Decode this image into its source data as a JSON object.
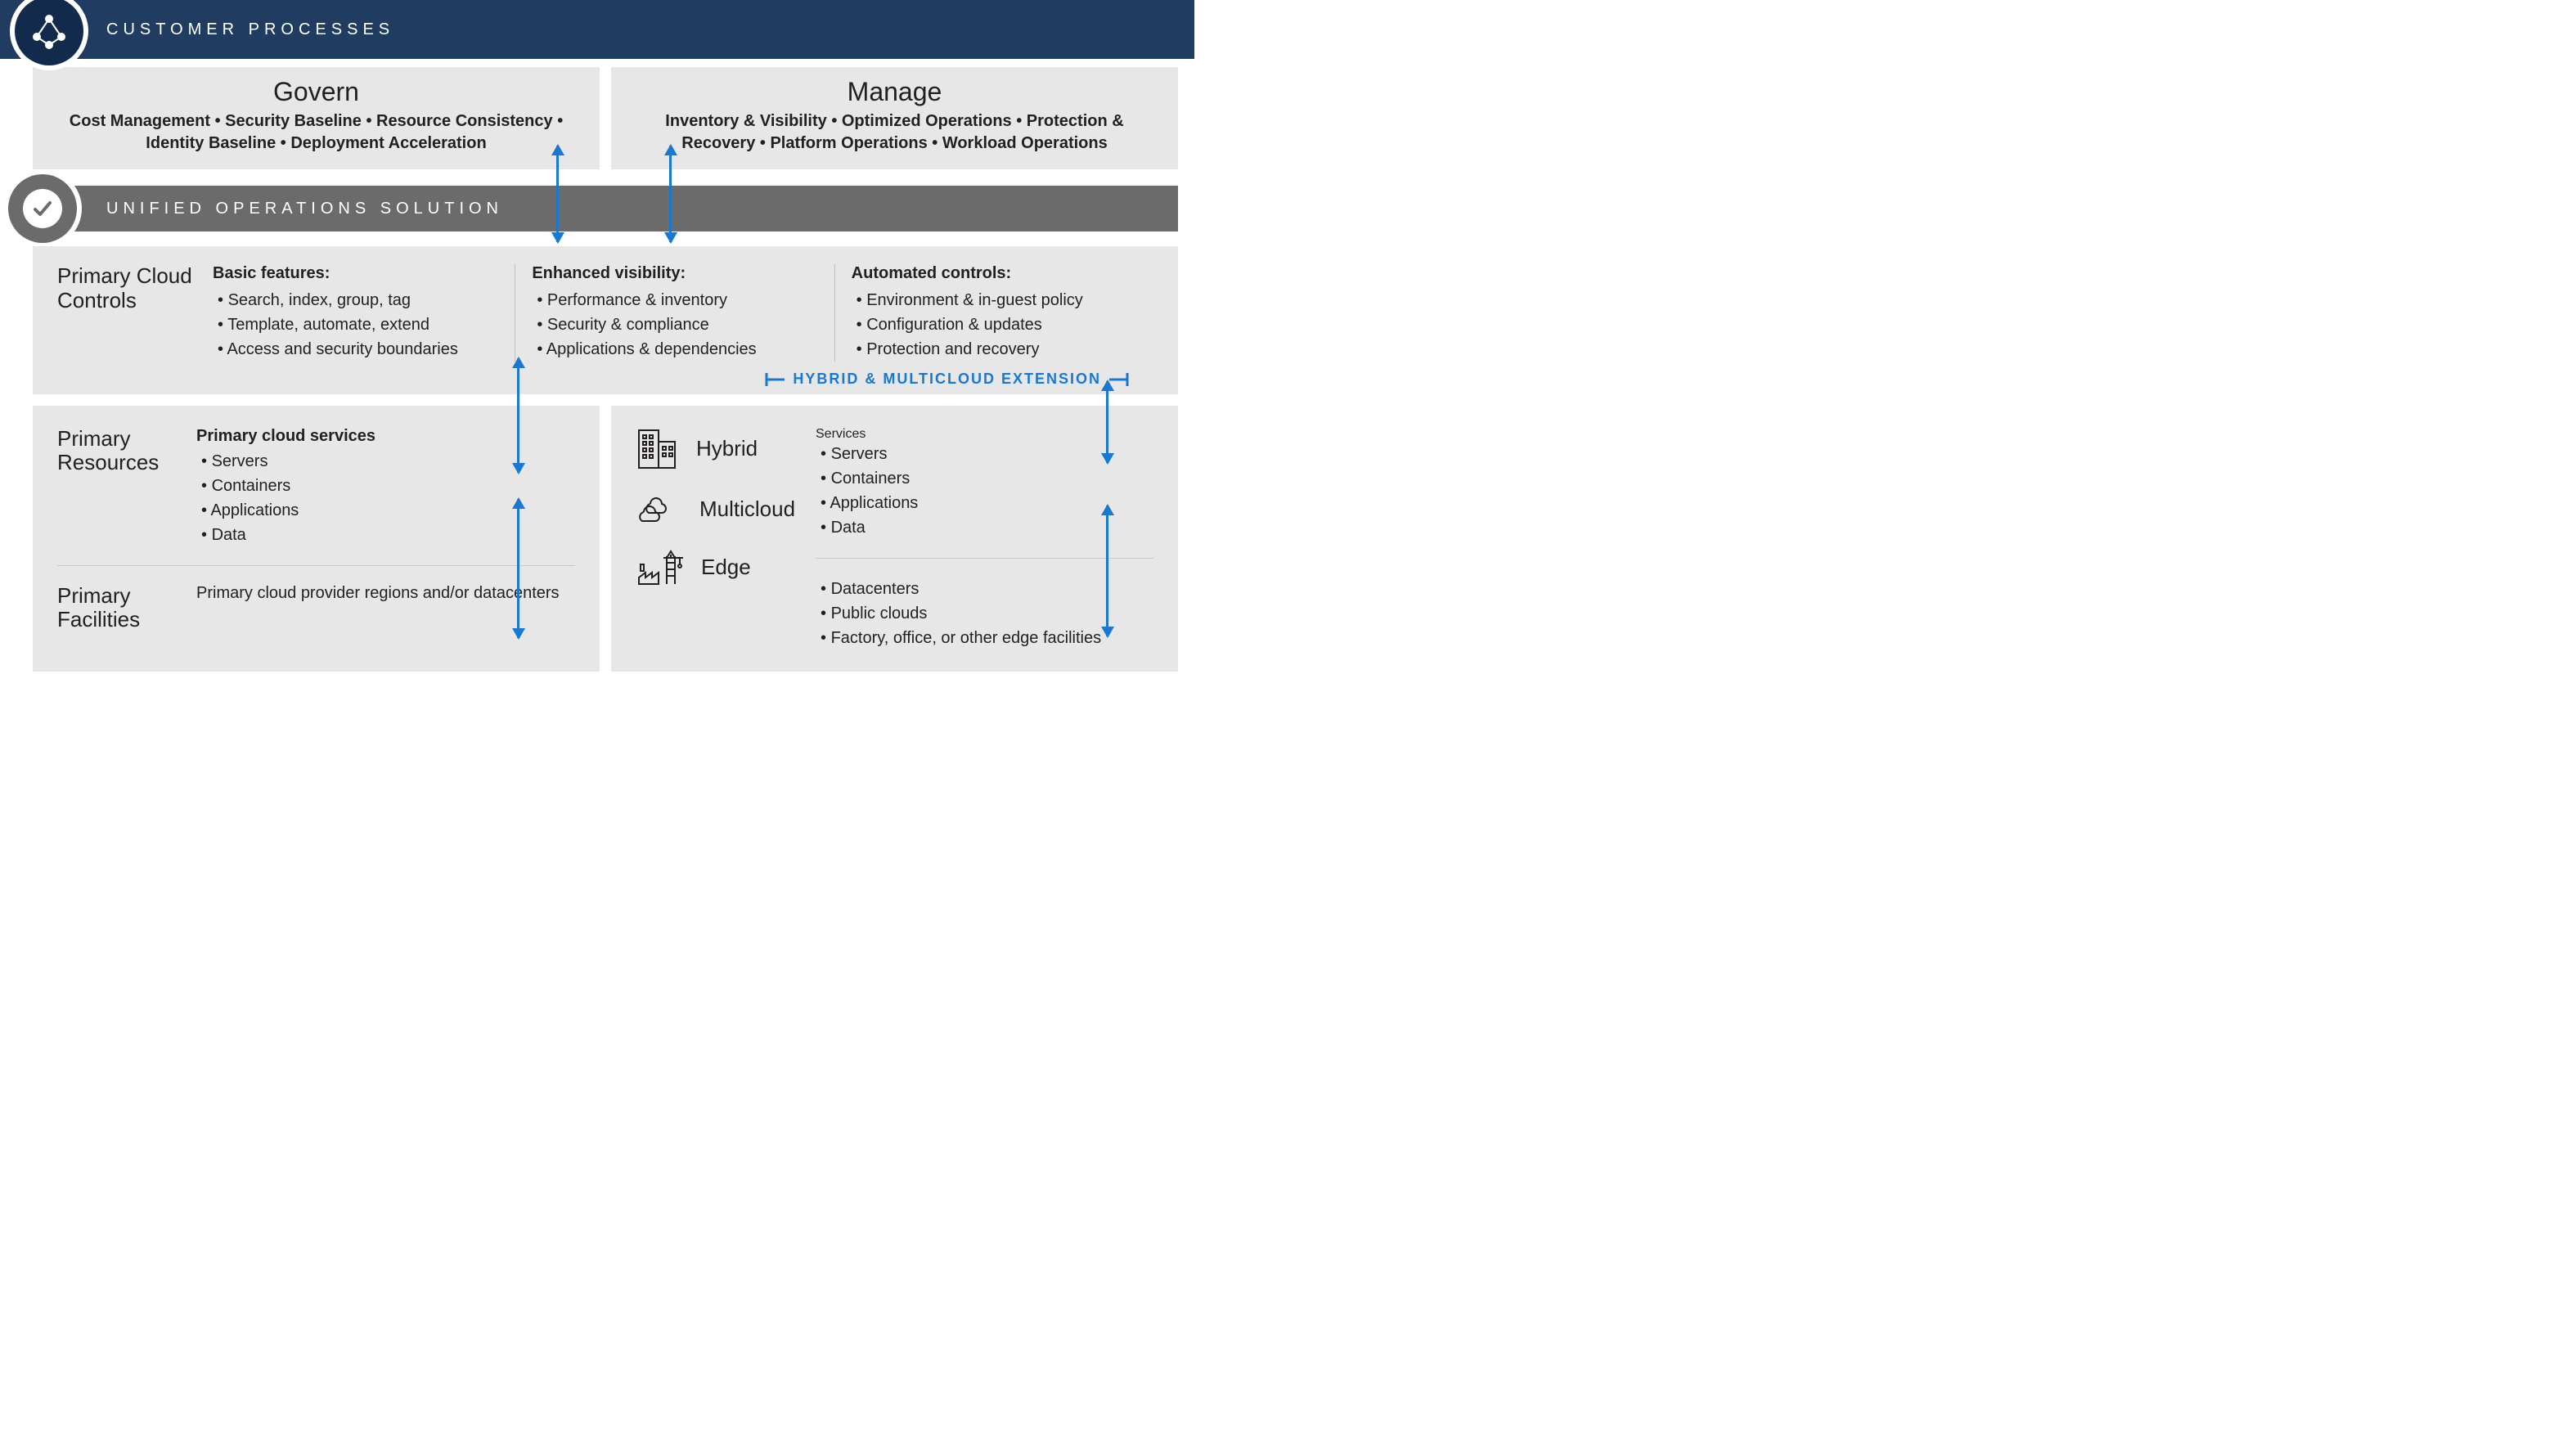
{
  "header": {
    "title": "CUSTOMER PROCESSES"
  },
  "govern": {
    "title": "Govern",
    "subtitle": "Cost Management • Security Baseline • Resource Consistency • Identity Baseline • Deployment Acceleration"
  },
  "manage": {
    "title": "Manage",
    "subtitle": "Inventory & Visibility • Optimized Operations • Protection & Recovery • Platform Operations • Workload Operations"
  },
  "unified": {
    "title": "UNIFIED OPERATIONS SOLUTION"
  },
  "pcc": {
    "title": "Primary Cloud Controls",
    "basic": {
      "title": "Basic features:",
      "i0": "Search, index, group, tag",
      "i1": "Template, automate, extend",
      "i2": "Access and security boundaries"
    },
    "visibility": {
      "title": "Enhanced visibility:",
      "i0": "Performance & inventory",
      "i1": "Security & compliance",
      "i2": "Applications & dependencies"
    },
    "automated": {
      "title": "Automated controls:",
      "i0": "Environment & in-guest policy",
      "i1": "Configuration & updates",
      "i2": "Protection and recovery"
    },
    "extension": "HYBRID & MULTICLOUD EXTENSION"
  },
  "left": {
    "resources": {
      "title": "Primary Resources",
      "heading": "Primary cloud services",
      "i0": "Servers",
      "i1": "Containers",
      "i2": "Applications",
      "i3": "Data"
    },
    "facilities": {
      "title": "Primary Facilities",
      "text": "Primary cloud provider regions and/or datacenters"
    }
  },
  "right": {
    "hybrid": "Hybrid",
    "multicloud": "Multicloud",
    "edge": "Edge",
    "services": {
      "heading": "Services",
      "i0": "Servers",
      "i1": "Containers",
      "i2": "Applications",
      "i3": "Data"
    },
    "facilities": {
      "i0": "Datacenters",
      "i1": "Public clouds",
      "i2": "Factory, office, or other edge facilities"
    }
  }
}
